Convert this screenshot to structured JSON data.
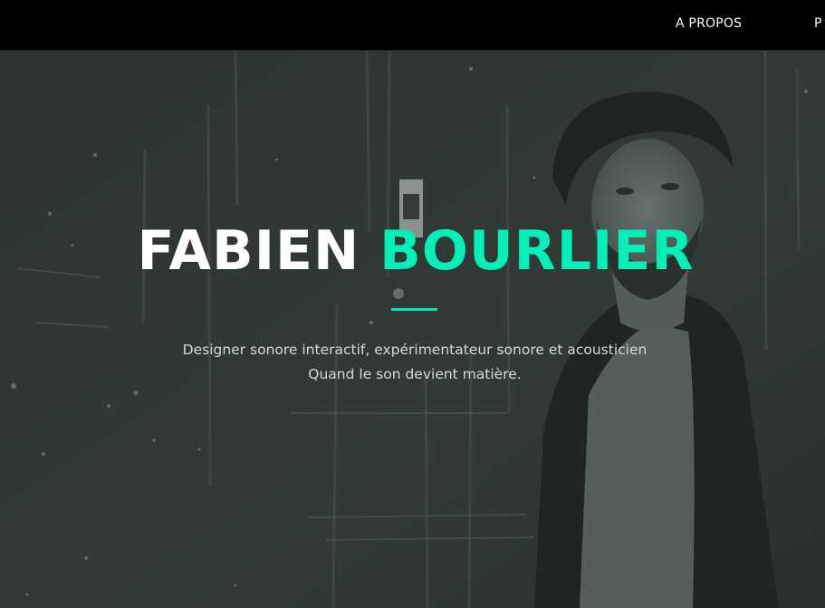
{
  "nav": {
    "items": [
      {
        "label": "A PROPOS"
      },
      {
        "label": "P"
      }
    ]
  },
  "hero": {
    "title_first": "FABIEN",
    "title_last": "BOURLIER",
    "tagline_line1": "Designer sonore interactif, expérimentateur sonore et acousticien",
    "tagline_line2": "Quand le son devient matière."
  },
  "colors": {
    "accent": "#00f0b5",
    "navbar": "#000000",
    "hero_tint": "#343b38"
  }
}
